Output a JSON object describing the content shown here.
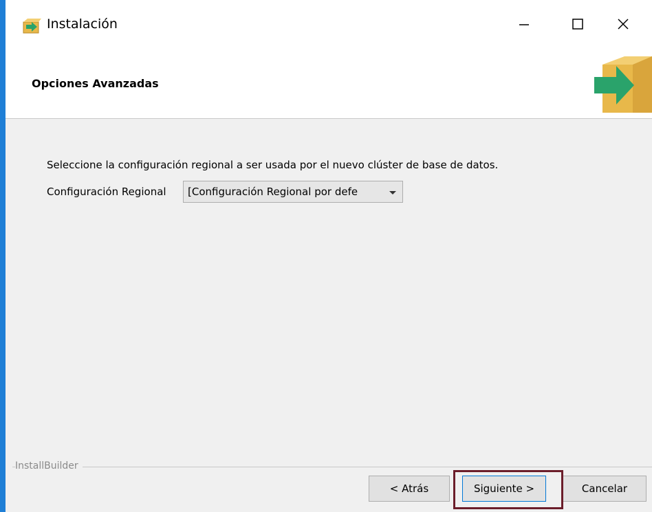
{
  "window": {
    "title": "Instalación",
    "controls": {
      "minimize_icon": "minimize-icon",
      "maximize_icon": "maximize-icon",
      "close_icon": "close-icon"
    }
  },
  "header": {
    "title": "Opciones Avanzadas",
    "icon": "installer-box-arrow-icon"
  },
  "content": {
    "description": "Seleccione la configuración regional a ser usada por el nuevo clúster de base de datos.",
    "locale": {
      "label": "Configuración Regional",
      "selected_value": "[Configuración Regional por defe"
    }
  },
  "footer": {
    "builder_label": "InstallBuilder",
    "back_label": "< Atrás",
    "next_label": "Siguiente >",
    "cancel_label": "Cancelar"
  },
  "colors": {
    "accent": "#1f7fd6",
    "highlight": "#6b1d2a",
    "box": "#e8b84a",
    "arrow": "#2aa36b"
  }
}
